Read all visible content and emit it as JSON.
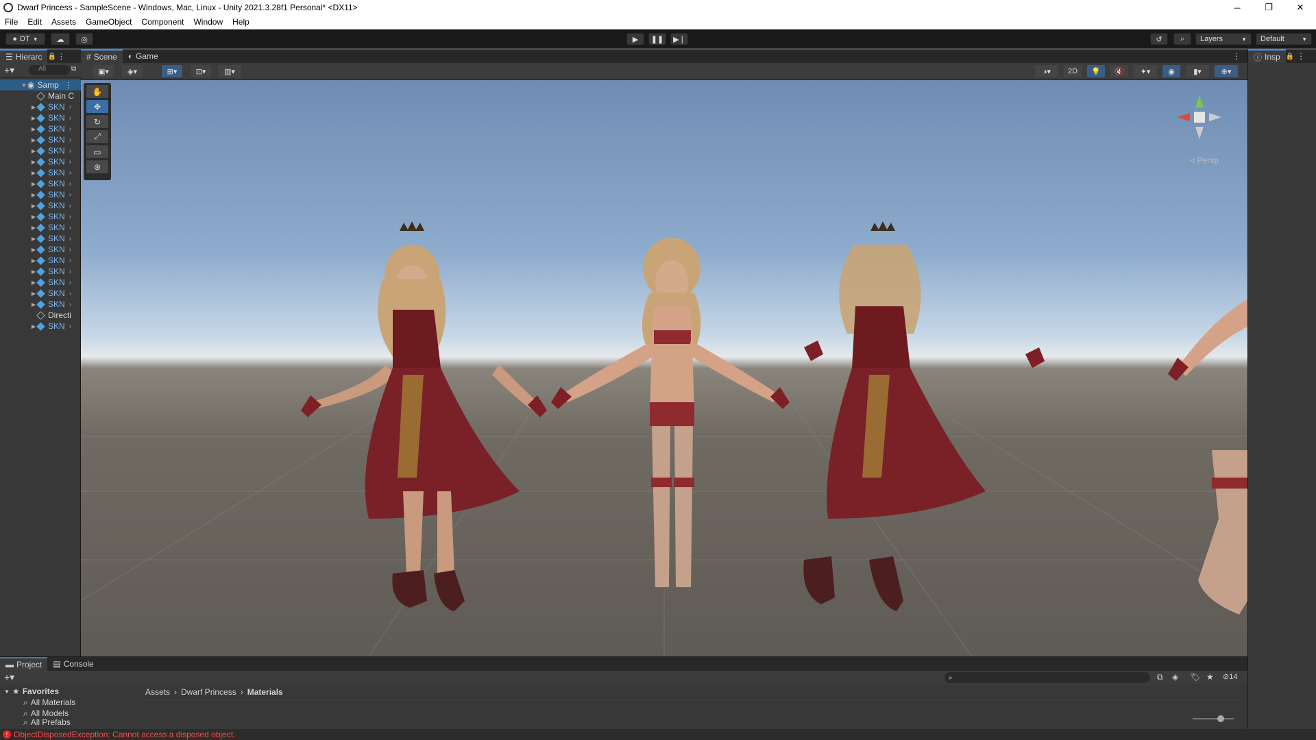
{
  "window": {
    "title": "Dwarf Princess - SampleScene - Windows, Mac, Linux - Unity 2021.3.28f1 Personal* <DX11>",
    "minimize": "─",
    "maximize": "❐",
    "close": "✕"
  },
  "menu": [
    "File",
    "Edit",
    "Assets",
    "GameObject",
    "Component",
    "Window",
    "Help"
  ],
  "toolbar": {
    "account": "DT",
    "layers": "Layers",
    "layout": "Default"
  },
  "hierarchy": {
    "tab": "Hierarc",
    "search_placeholder": "All",
    "scene_name": "Samp",
    "items": [
      {
        "label": "Main C",
        "type": "object"
      },
      {
        "label": "SKN",
        "type": "prefab"
      },
      {
        "label": "SKN",
        "type": "prefab"
      },
      {
        "label": "SKN",
        "type": "prefab"
      },
      {
        "label": "SKN",
        "type": "prefab"
      },
      {
        "label": "SKN",
        "type": "prefab"
      },
      {
        "label": "SKN",
        "type": "prefab"
      },
      {
        "label": "SKN",
        "type": "prefab"
      },
      {
        "label": "SKN",
        "type": "prefab"
      },
      {
        "label": "SKN",
        "type": "prefab"
      },
      {
        "label": "SKN",
        "type": "prefab"
      },
      {
        "label": "SKN",
        "type": "prefab"
      },
      {
        "label": "SKN",
        "type": "prefab"
      },
      {
        "label": "SKN",
        "type": "prefab"
      },
      {
        "label": "SKN",
        "type": "prefab"
      },
      {
        "label": "SKN",
        "type": "prefab"
      },
      {
        "label": "SKN",
        "type": "prefab"
      },
      {
        "label": "SKN",
        "type": "prefab"
      },
      {
        "label": "SKN",
        "type": "prefab"
      },
      {
        "label": "SKN",
        "type": "prefab"
      },
      {
        "label": "Directi",
        "type": "object"
      },
      {
        "label": "SKN",
        "type": "prefab"
      }
    ]
  },
  "scene": {
    "tabs": [
      {
        "label": "Scene",
        "icon": "grid-icon"
      },
      {
        "label": "Game",
        "icon": "gamepad-icon"
      }
    ],
    "mode_2d": "2D",
    "persp_label": "< Persp"
  },
  "inspector": {
    "tab": "Insp"
  },
  "project": {
    "tabs": [
      "Project",
      "Console"
    ],
    "favorites_label": "Favorites",
    "favorites": [
      "All Materials",
      "All Models",
      "All Prefabs"
    ],
    "breadcrumb": [
      "Assets",
      "Dwarf Princess",
      "Materials"
    ],
    "hidden_count": "14"
  },
  "status": {
    "message": "ObjectDisposedException: Cannot access a disposed object."
  }
}
